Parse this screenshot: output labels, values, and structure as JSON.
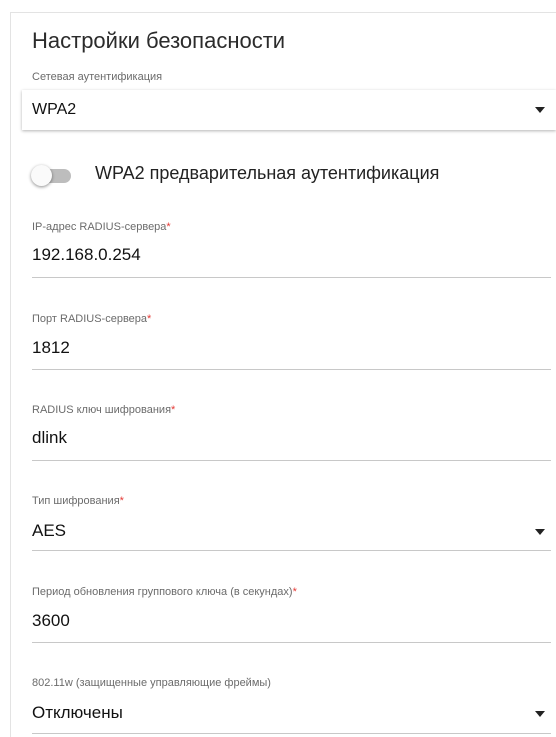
{
  "section": {
    "title": "Настройки безопасности"
  },
  "auth": {
    "label": "Сетевая аутентификация",
    "value": "WPA2"
  },
  "preauth": {
    "label": "WPA2 предварительная аутентификация",
    "enabled": false
  },
  "radius_ip": {
    "label": "IP-адрес RADIUS-сервера",
    "required_mark": "*",
    "value": "192.168.0.254"
  },
  "radius_port": {
    "label": "Порт RADIUS-сервера",
    "required_mark": "*",
    "value": "1812"
  },
  "radius_key": {
    "label": "RADIUS ключ шифрования",
    "required_mark": "*",
    "value": "dlink"
  },
  "encryption": {
    "label": "Тип шифрования",
    "required_mark": "*",
    "value": "AES"
  },
  "group_key": {
    "label": "Период обновления группового ключа (в секундах)",
    "required_mark": "*",
    "value": "3600"
  },
  "pmf": {
    "label": "802.11w (защищенные управляющие фреймы)",
    "value": "Отключены"
  },
  "colors": {
    "required": "#e53935",
    "label": "#6b6b6b",
    "toggle_off": "#bdbdbd"
  }
}
